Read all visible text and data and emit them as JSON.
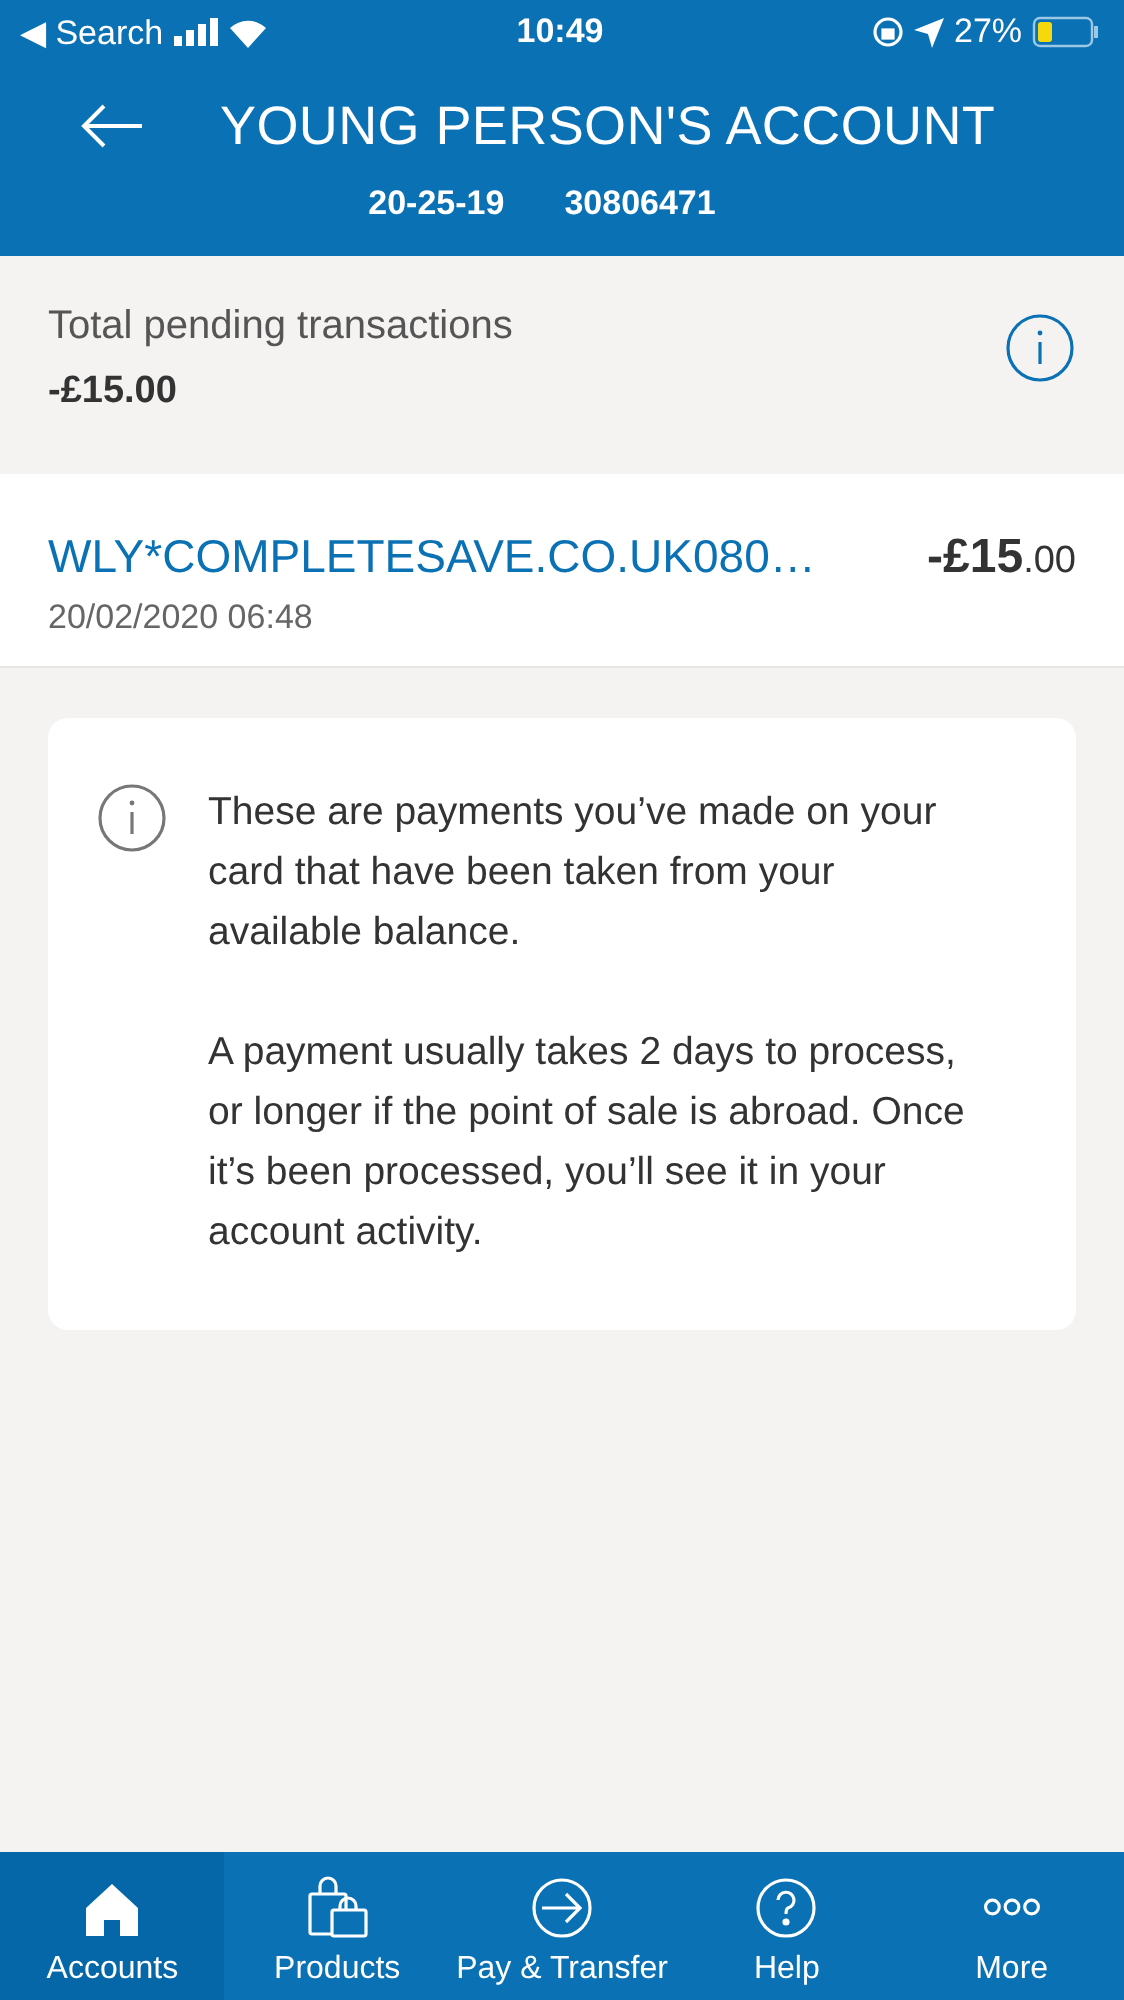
{
  "status_bar": {
    "back_label": "◀ Search",
    "time": "10:49",
    "battery": "27%"
  },
  "header": {
    "title": "YOUNG PERSON'S ACCOUNT",
    "sort_code": "20-25-19",
    "account_number": "30806471"
  },
  "pending": {
    "label": "Total pending transactions",
    "total": "-£15.00"
  },
  "transactions": [
    {
      "description": "WLY*COMPLETESAVE.CO.UK080…",
      "date": "20/02/2020 06:48",
      "amount": "-£15.00"
    }
  ],
  "info": {
    "paragraphs": [
      "These are payments you’ve made on your card that have been taken from your available balance.",
      "A payment usually takes 2 days to process, or longer if the point of sale is abroad. Once it’s been processed, you’ll see it in your account activity."
    ]
  },
  "tabs": [
    {
      "label": "Accounts",
      "kind": "home",
      "selected": true
    },
    {
      "label": "Products",
      "kind": "bags",
      "selected": false
    },
    {
      "label": "Pay & Transfer",
      "kind": "arrow",
      "selected": false
    },
    {
      "label": "Help",
      "kind": "help",
      "selected": false
    },
    {
      "label": "More",
      "kind": "more",
      "selected": false
    }
  ]
}
